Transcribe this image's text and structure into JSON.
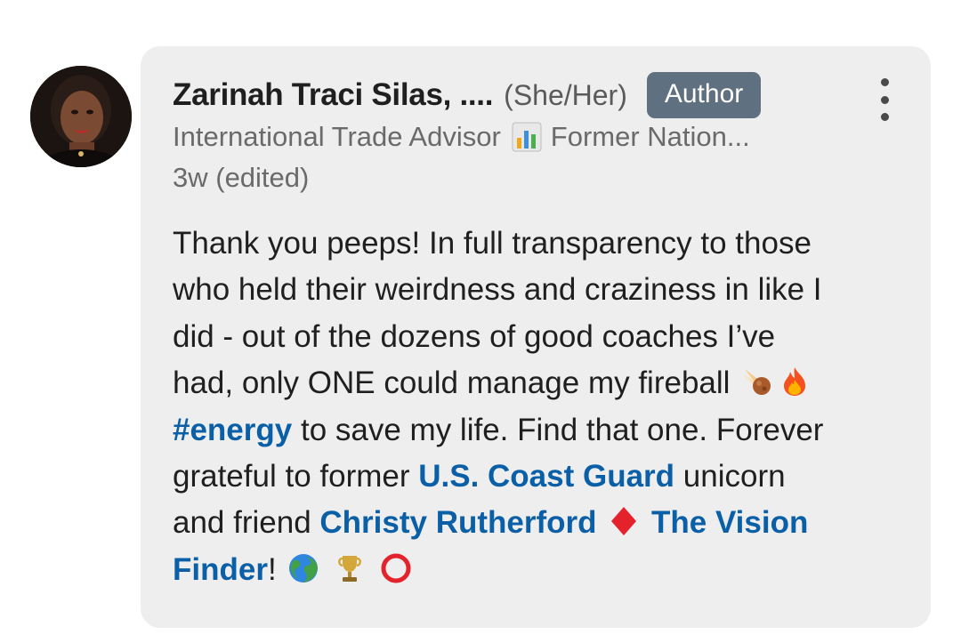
{
  "comment": {
    "author": {
      "name": "Zarinah Traci Silas, ....",
      "pronouns": "(She/Her)",
      "badge": "Author",
      "headline_before": "International Trade Advisor",
      "headline_icon": "bar-chart-emoji",
      "headline_after": "Former Nation...",
      "timestamp": "3w (edited)"
    },
    "menu_icon": "more-vertical-icon",
    "body": {
      "line1": "Thank you peeps! In full transparency to those",
      "line2": "who held their weirdness and craziness in like I",
      "line3": "did - out of the dozens of good coaches I’ve",
      "line4": "had, only ONE could manage my fireball",
      "hashtag": "#energy",
      "line5_rest": " to save my life. Find that one. Forever",
      "line6_pre": "grateful to former ",
      "mention_org": "U.S. Coast Guard",
      "line6_post": " unicorn",
      "line7_pre": "and friend ",
      "mention_person": "Christy Rutherford",
      "mention_page_part1": "The Vision",
      "mention_page_part2": "Finder",
      "line8_post": "!",
      "emojis": [
        "comet-emoji",
        "fire-emoji",
        "diamond-emoji",
        "globe-emoji",
        "trophy-emoji",
        "red-circle-emoji"
      ]
    }
  },
  "colors": {
    "bubble_bg": "#eeeeee",
    "badge_bg": "#5f7080",
    "link": "#0a5fa6",
    "text": "#1f1f1f",
    "muted": "#6a6a6a"
  }
}
